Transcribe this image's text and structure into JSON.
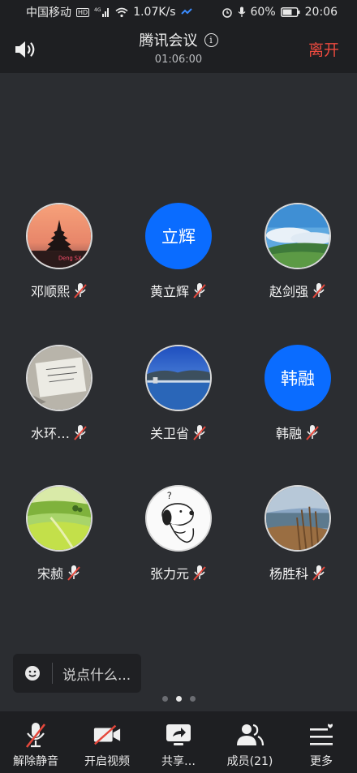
{
  "status_bar": {
    "carrier": "中国移动",
    "network_badge": "HD",
    "signal_type": "4G",
    "speed": "1.07K/s",
    "battery": "60%",
    "time": "20:06"
  },
  "header": {
    "title": "腾讯会议",
    "timer": "01:06:00",
    "leave_label": "离开"
  },
  "participants": [
    {
      "name": "邓顺熙",
      "avatar_type": "image",
      "avatar_caption": "Deng SX",
      "mic": "muted"
    },
    {
      "name": "黄立辉",
      "avatar_type": "text",
      "avatar_text": "立辉",
      "mic": "muted"
    },
    {
      "name": "赵剑强",
      "avatar_type": "image",
      "mic": "muted"
    },
    {
      "name": "水环…",
      "avatar_type": "image",
      "mic": "muted"
    },
    {
      "name": "关卫省",
      "avatar_type": "image",
      "mic": "muted"
    },
    {
      "name": "韩融",
      "avatar_type": "text",
      "avatar_text": "韩融",
      "mic": "muted"
    },
    {
      "name": "宋赪",
      "avatar_type": "image",
      "mic": "muted"
    },
    {
      "name": "张力元",
      "avatar_type": "image",
      "mic": "muted"
    },
    {
      "name": "杨胜科",
      "avatar_type": "image",
      "mic": "muted"
    }
  ],
  "chat": {
    "placeholder": "说点什么..."
  },
  "pager": {
    "pages": 3,
    "current": 2
  },
  "toolbar": {
    "unmute_label": "解除静音",
    "video_label": "开启视频",
    "share_label": "共享…",
    "members_label": "成员(21)",
    "more_label": "更多"
  },
  "colors": {
    "accent_blue": "#0a6cff",
    "leave_red": "#ec4a3f",
    "mute_red": "#e5483c",
    "background": "#2b2d31",
    "bar": "#1e1f22"
  }
}
